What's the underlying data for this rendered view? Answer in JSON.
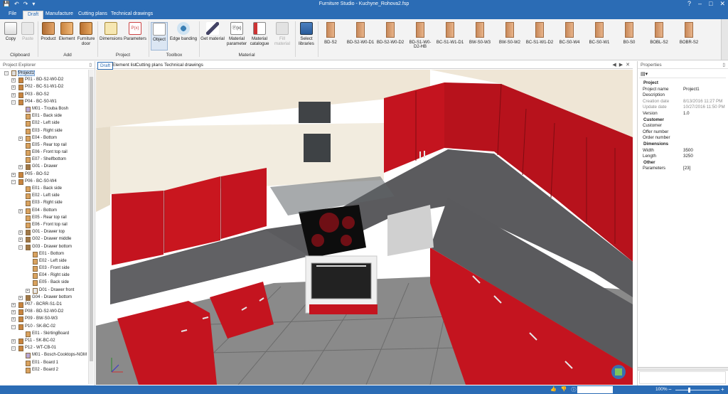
{
  "window": {
    "title": "Furniture Studio - Kuchyne_Rohova2.fsp"
  },
  "ribbon_tabs": [
    {
      "label": "File"
    },
    {
      "label": "Draft"
    },
    {
      "label": "Manufacture"
    },
    {
      "label": "Cutting plans"
    },
    {
      "label": "Technical drawings"
    }
  ],
  "ribbon": {
    "buttons": {
      "copy": "Copy",
      "paste": "Paste",
      "product": "Product",
      "element": "Element",
      "furniture_door": "Furniture door",
      "dimensions": "Dimensions",
      "parameters": "Parameters",
      "object": "Object",
      "edge_banding": "Edge banding",
      "get_material": "Get material",
      "material_parameter": "Material parameter",
      "material_catalogue": "Material catalogue",
      "fill_material": "Fill material",
      "select_libraries": "Select libraries"
    },
    "groups": {
      "clipboard": "Clipboard",
      "add": "Add",
      "project": "Project",
      "toolbox": "Toolbox",
      "material": "Material"
    },
    "library": [
      "BD-S2",
      "BD-S2-W0-D1",
      "BD-S2-W0-D2",
      "BD-S1-W0-D2-HB",
      "BC-S1-W1-D1",
      "BW-S0-W3",
      "BW-S0-W2",
      "BC-S1-W1-D2",
      "BC-S0-W4",
      "BC-S0-W1",
      "B0-S0",
      "BOBL-S2",
      "BOBR-S2"
    ]
  },
  "explorer": {
    "title": "Project Explorer",
    "items": [
      {
        "label": "Project1",
        "depth": 0,
        "expander": "-",
        "icon": "project"
      },
      {
        "label": "P01 - BD-S2-W0-D2",
        "depth": 1,
        "expander": "+",
        "icon": "product"
      },
      {
        "label": "P02 - BC-S1-W1-D2",
        "depth": 1,
        "expander": "+",
        "icon": "product"
      },
      {
        "label": "P03 - BO-S2",
        "depth": 1,
        "expander": "+",
        "icon": "product"
      },
      {
        "label": "P04 - BC-S0-W1",
        "depth": 1,
        "expander": "-",
        "icon": "product"
      },
      {
        "label": "M01 - Trouba Bosh",
        "depth": 2,
        "expander": "",
        "icon": "appliance"
      },
      {
        "label": "E01 - Back side",
        "depth": 2,
        "expander": "",
        "icon": "board"
      },
      {
        "label": "E02 - Left side",
        "depth": 2,
        "expander": "",
        "icon": "board"
      },
      {
        "label": "E03 - Right side",
        "depth": 2,
        "expander": "",
        "icon": "board"
      },
      {
        "label": "E04 - Bottom",
        "depth": 2,
        "expander": "+",
        "icon": "board"
      },
      {
        "label": "E05 - Rear top rail",
        "depth": 2,
        "expander": "",
        "icon": "board"
      },
      {
        "label": "E06 - Front top rail",
        "depth": 2,
        "expander": "",
        "icon": "board"
      },
      {
        "label": "E07 - Shelfbottom",
        "depth": 2,
        "expander": "",
        "icon": "board"
      },
      {
        "label": "G01 - Drawer",
        "depth": 2,
        "expander": "+",
        "icon": "drawer"
      },
      {
        "label": "P05 - BO-S2",
        "depth": 1,
        "expander": "+",
        "icon": "product"
      },
      {
        "label": "P06 - BC-S0-W4",
        "depth": 1,
        "expander": "-",
        "icon": "product"
      },
      {
        "label": "E01 - Back side",
        "depth": 2,
        "expander": "",
        "icon": "board"
      },
      {
        "label": "E02 - Left side",
        "depth": 2,
        "expander": "",
        "icon": "board"
      },
      {
        "label": "E03 - Right side",
        "depth": 2,
        "expander": "",
        "icon": "board"
      },
      {
        "label": "E04 - Bottom",
        "depth": 2,
        "expander": "+",
        "icon": "board"
      },
      {
        "label": "E05 - Rear top rail",
        "depth": 2,
        "expander": "",
        "icon": "board"
      },
      {
        "label": "E06 - Front top rail",
        "depth": 2,
        "expander": "",
        "icon": "board"
      },
      {
        "label": "G01 - Drawer top",
        "depth": 2,
        "expander": "+",
        "icon": "drawer"
      },
      {
        "label": "G02 - Drawer middle",
        "depth": 2,
        "expander": "+",
        "icon": "drawer"
      },
      {
        "label": "G03 - Drawer bottom",
        "depth": 2,
        "expander": "-",
        "icon": "drawer"
      },
      {
        "label": "E01 - Bottom",
        "depth": 3,
        "expander": "",
        "icon": "board"
      },
      {
        "label": "E02 - Left side",
        "depth": 3,
        "expander": "",
        "icon": "board"
      },
      {
        "label": "E03 - Front side",
        "depth": 3,
        "expander": "",
        "icon": "board"
      },
      {
        "label": "E04 - Right side",
        "depth": 3,
        "expander": "",
        "icon": "board"
      },
      {
        "label": "E05 - Back side",
        "depth": 3,
        "expander": "",
        "icon": "board"
      },
      {
        "label": "D01 - Drawer front",
        "depth": 3,
        "expander": "+",
        "icon": "door"
      },
      {
        "label": "G04 - Drawer bottom",
        "depth": 2,
        "expander": "+",
        "icon": "drawer"
      },
      {
        "label": "P07 - BCRR-S1-D1",
        "depth": 1,
        "expander": "+",
        "icon": "product"
      },
      {
        "label": "P08 - BD-S2-W0-D2",
        "depth": 1,
        "expander": "+",
        "icon": "product"
      },
      {
        "label": "P09 - BW-S0-W3",
        "depth": 1,
        "expander": "+",
        "icon": "product"
      },
      {
        "label": "P10 - SK-BC-02",
        "depth": 1,
        "expander": "-",
        "icon": "product"
      },
      {
        "label": "E01 - SkirtingBoard",
        "depth": 2,
        "expander": "",
        "icon": "board"
      },
      {
        "label": "P11 - SK-BC-02",
        "depth": 1,
        "expander": "+",
        "icon": "product"
      },
      {
        "label": "P12 - WT-CB-01",
        "depth": 1,
        "expander": "-",
        "icon": "product"
      },
      {
        "label": "M01 - Bosch-Cooktops-NGM",
        "depth": 2,
        "expander": "",
        "icon": "appliance"
      },
      {
        "label": "E01 - Board 1",
        "depth": 2,
        "expander": "",
        "icon": "board"
      },
      {
        "label": "E02 - Board 2",
        "depth": 2,
        "expander": "",
        "icon": "board"
      }
    ]
  },
  "doc_tabs": [
    {
      "label": "Draft"
    },
    {
      "label": "Element list"
    },
    {
      "label": "Cutting plans"
    },
    {
      "label": "Technical drawings"
    }
  ],
  "properties": {
    "title": "Properties",
    "rows": [
      {
        "type": "cat",
        "k": "Project",
        "v": ""
      },
      {
        "type": "row",
        "k": "Project name",
        "v": "Project1"
      },
      {
        "type": "row",
        "k": "Description",
        "v": ""
      },
      {
        "type": "dis",
        "k": "Creation date",
        "v": "8/13/2016 11:27 PM"
      },
      {
        "type": "dis",
        "k": "Update date",
        "v": "10/27/2016 11:50 PM"
      },
      {
        "type": "row",
        "k": "Version",
        "v": "1.0"
      },
      {
        "type": "cat",
        "k": "Customer",
        "v": ""
      },
      {
        "type": "row",
        "k": "Customer",
        "v": ""
      },
      {
        "type": "row",
        "k": "Offer number",
        "v": ""
      },
      {
        "type": "row",
        "k": "Order number",
        "v": ""
      },
      {
        "type": "cat",
        "k": "Dimensions",
        "v": ""
      },
      {
        "type": "row",
        "k": "Width",
        "v": "3500"
      },
      {
        "type": "row",
        "k": "Length",
        "v": "3250"
      },
      {
        "type": "cat",
        "k": "Other",
        "v": ""
      },
      {
        "type": "row",
        "k": "Parameters",
        "v": "[23]"
      }
    ]
  },
  "status": {
    "zoom": "100%"
  },
  "colors": {
    "accent": "#2b6cb5",
    "cabinet_red": "#c4141f",
    "countertop": "#5b5b5e",
    "cream": "#efe6d6",
    "floor": "#7a7a7a"
  }
}
